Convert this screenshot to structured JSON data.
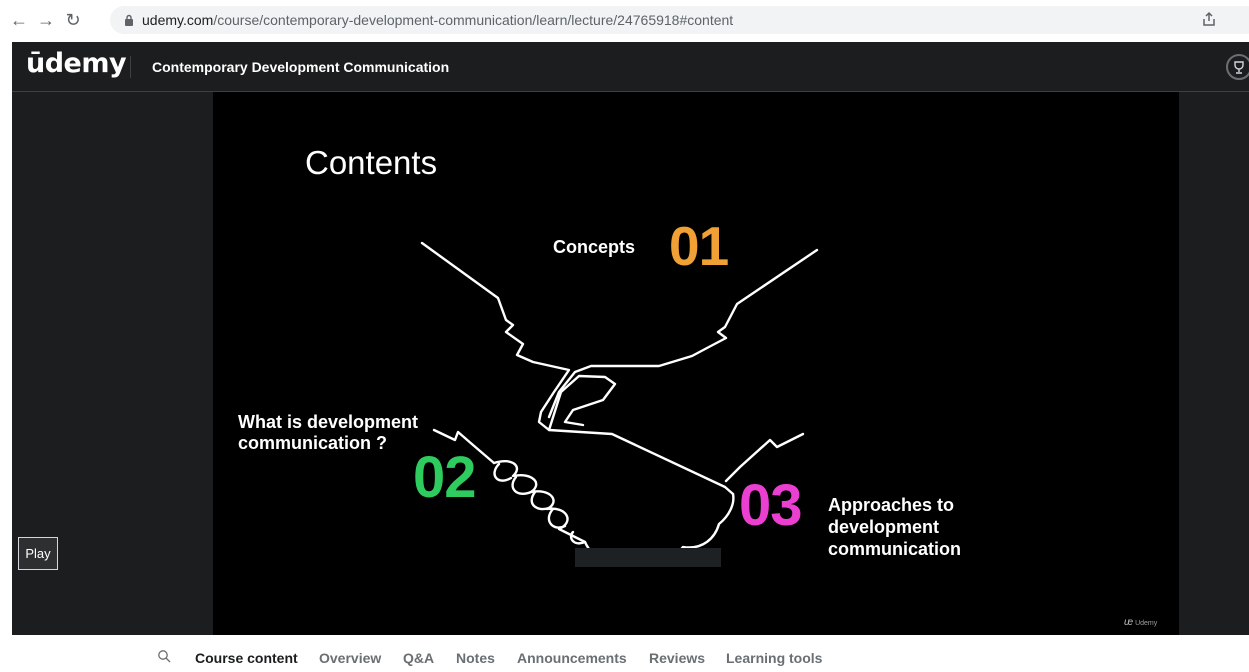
{
  "browser": {
    "url_host": "udemy.com",
    "url_path": "/course/contemporary-development-communication/learn/lecture/24765918#content",
    "back_icon": "arrow-left-icon",
    "forward_icon": "arrow-right-icon",
    "reload_icon": "reload-icon"
  },
  "header": {
    "logo": "ūdemy",
    "course_title": "Contemporary Development Communication"
  },
  "slide": {
    "title": "Contents",
    "item1_label": "Concepts",
    "item1_number": "01",
    "item2_label": "What is development communication ?",
    "item2_number": "02",
    "item3_label": "Approaches to development communication",
    "item3_number": "03",
    "watermark": "Udemy",
    "colors": {
      "num1": "#f0a034",
      "num2": "#2ecc5e",
      "num3": "#ea3fd1"
    }
  },
  "player": {
    "play_label": "Play"
  },
  "tabs": [
    "Course content",
    "Overview",
    "Q&A",
    "Notes",
    "Announcements",
    "Reviews",
    "Learning tools"
  ],
  "active_tab": "Course content"
}
